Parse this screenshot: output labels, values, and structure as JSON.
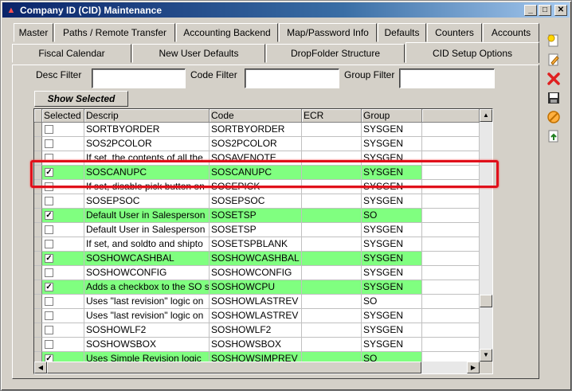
{
  "window": {
    "title": "Company ID (CID) Maintenance"
  },
  "tabs_row1": [
    "Master",
    "Paths / Remote Transfer",
    "Accounting Backend",
    "Map/Password Info",
    "Defaults",
    "Counters",
    "Accounts"
  ],
  "tabs_row2": [
    "Fiscal Calendar",
    "New User Defaults",
    "DropFolder Structure",
    "CID Setup Options"
  ],
  "active_tab": "CID Setup Options",
  "filters": {
    "desc_label": "Desc Filter",
    "code_label": "Code Filter",
    "group_label": "Group Filter",
    "desc_value": "",
    "code_value": "",
    "group_value": ""
  },
  "show_selected_label": "Show Selected",
  "grid": {
    "columns": [
      "Selected",
      "Descrip",
      "Code",
      "ECR",
      "Group",
      ""
    ],
    "rows": [
      {
        "selected": false,
        "descrip": "SORTBYORDER",
        "code": "SORTBYORDER",
        "ecr": "",
        "group": "SYSGEN",
        "green": false
      },
      {
        "selected": false,
        "descrip": "SOS2PCOLOR",
        "code": "SOS2PCOLOR",
        "ecr": "",
        "group": "SYSGEN",
        "green": false
      },
      {
        "selected": false,
        "descrip": "If set, the contents of all the",
        "code": "SOSAVENOTE",
        "ecr": "",
        "group": "SYSGEN",
        "green": false
      },
      {
        "selected": true,
        "descrip": "SOSCANUPC",
        "code": "SOSCANUPC",
        "ecr": "",
        "group": "SYSGEN",
        "green": true
      },
      {
        "selected": false,
        "descrip": "If set, disable pick button on",
        "code": "SOSEPICK",
        "ecr": "",
        "group": "SYSGEN",
        "green": false
      },
      {
        "selected": false,
        "descrip": "SOSEPSOC",
        "code": "SOSEPSOC",
        "ecr": "",
        "group": "SYSGEN",
        "green": false
      },
      {
        "selected": true,
        "descrip": "Default User in Salesperson",
        "code": "SOSETSP",
        "ecr": "",
        "group": "SO",
        "green": true
      },
      {
        "selected": false,
        "descrip": "Default User in Salesperson",
        "code": "SOSETSP",
        "ecr": "",
        "group": "SYSGEN",
        "green": false
      },
      {
        "selected": false,
        "descrip": "If set, and soldto and shipto",
        "code": "SOSETSPBLANK",
        "ecr": "",
        "group": "SYSGEN",
        "green": false
      },
      {
        "selected": true,
        "descrip": "SOSHOWCASHBAL",
        "code": "SOSHOWCASHBAL",
        "ecr": "",
        "group": "SYSGEN",
        "green": true
      },
      {
        "selected": false,
        "descrip": "SOSHOWCONFIG",
        "code": "SOSHOWCONFIG",
        "ecr": "",
        "group": "SYSGEN",
        "green": false
      },
      {
        "selected": true,
        "descrip": "Adds a checkbox to the SO s",
        "code": "SOSHOWCPU",
        "ecr": "",
        "group": "SYSGEN",
        "green": true
      },
      {
        "selected": false,
        "descrip": "Uses \"last revision\" logic on",
        "code": "SOSHOWLASTREV",
        "ecr": "",
        "group": "SO",
        "green": false
      },
      {
        "selected": false,
        "descrip": "Uses \"last revision\" logic on",
        "code": "SOSHOWLASTREV",
        "ecr": "",
        "group": "SYSGEN",
        "green": false
      },
      {
        "selected": false,
        "descrip": "SOSHOWLF2",
        "code": "SOSHOWLF2",
        "ecr": "",
        "group": "SYSGEN",
        "green": false
      },
      {
        "selected": false,
        "descrip": "SOSHOWSBOX",
        "code": "SOSHOWSBOX",
        "ecr": "",
        "group": "SYSGEN",
        "green": false
      },
      {
        "selected": true,
        "descrip": "Uses Simple Revision logic",
        "code": "SOSHOWSIMPREV",
        "ecr": "",
        "group": "SO",
        "green": true
      }
    ]
  },
  "colors": {
    "selected_row": "#80ff80",
    "highlight_box": "#e0101a",
    "title_bar": "#0a246a"
  },
  "toolbar_icons": [
    "new-record-icon",
    "edit-icon",
    "delete-icon",
    "save-icon",
    "cancel-icon",
    "refresh-icon"
  ]
}
